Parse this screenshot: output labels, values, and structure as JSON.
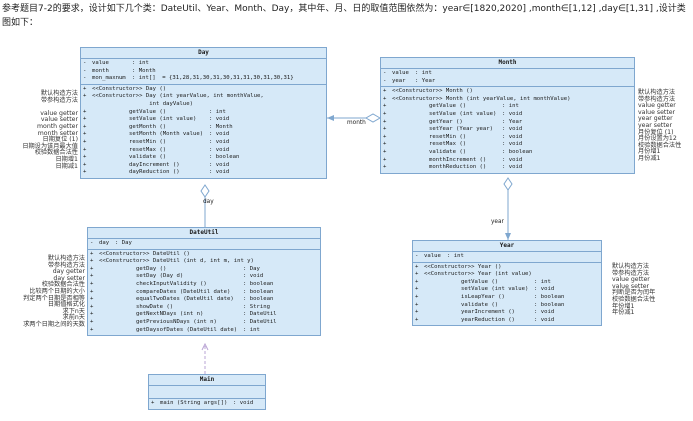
{
  "intro": "参考题目7-2的要求，设计如下几个类：DateUtil、Year、Month、Day，其中年、月、日的取值范围依然为：year∈[1820,2020] ,month∈[1,12] ,day∈[1,31] ,设计类图如下：",
  "day": {
    "title": "Day",
    "attrs": [
      {
        "vis": "-",
        "name": "value",
        "type": ": int"
      },
      {
        "vis": "-",
        "name": "month",
        "type": ": Month"
      },
      {
        "vis": "-",
        "name": "mon_maxnum",
        "type": ": int[]  = {31,28,31,30,31,30,31,31,30,31,30,31}"
      }
    ],
    "ops": [
      {
        "vis": "+",
        "name": "<<Constructor>> Day ()",
        "type": ""
      },
      {
        "vis": "+",
        "name": "<<Constructor>> Day (int yearValue, int monthValue,",
        "type": ""
      },
      {
        "vis": "",
        "name": "                 int dayValue)",
        "type": ""
      },
      {
        "vis": "+",
        "name": "           getValue ()",
        "type": ": int"
      },
      {
        "vis": "+",
        "name": "           setValue (int value)",
        "type": ": void"
      },
      {
        "vis": "+",
        "name": "           getMonth ()",
        "type": ": Month"
      },
      {
        "vis": "+",
        "name": "           setMonth (Month value)",
        "type": ": void"
      },
      {
        "vis": "+",
        "name": "           resetMin ()",
        "type": ": void"
      },
      {
        "vis": "+",
        "name": "           resetMax ()",
        "type": ": void"
      },
      {
        "vis": "+",
        "name": "           validate ()",
        "type": ": boolean"
      },
      {
        "vis": "+",
        "name": "           dayIncrement ()",
        "type": ": void"
      },
      {
        "vis": "+",
        "name": "           dayReduction ()",
        "type": ": void"
      }
    ],
    "notes": [
      "默认构造方法",
      "带参构造方法",
      "",
      "value getter",
      "value setter",
      "month getter",
      "month setter",
      "日期复位 (1)",
      "日期设为该月最大值",
      "校验数据合法性",
      "日期增1",
      "日期减1"
    ]
  },
  "month": {
    "title": "Month",
    "attrs": [
      {
        "vis": "-",
        "name": "value",
        "type": ": int"
      },
      {
        "vis": "-",
        "name": "year",
        "type": ": Year"
      }
    ],
    "ops": [
      {
        "vis": "+",
        "name": "<<Constructor>> Month ()",
        "type": ""
      },
      {
        "vis": "+",
        "name": "<<Constructor>> Month (int yearValue, int monthValue)",
        "type": ""
      },
      {
        "vis": "+",
        "name": "           getValue ()",
        "type": ": int"
      },
      {
        "vis": "+",
        "name": "           setValue (int value)",
        "type": ": void"
      },
      {
        "vis": "+",
        "name": "           getYear ()",
        "type": ": Year"
      },
      {
        "vis": "+",
        "name": "           setYear (Year year)",
        "type": ": void"
      },
      {
        "vis": "+",
        "name": "           resetMin ()",
        "type": ": void"
      },
      {
        "vis": "+",
        "name": "           resetMax ()",
        "type": ": void"
      },
      {
        "vis": "+",
        "name": "           validate ()",
        "type": ": boolean"
      },
      {
        "vis": "+",
        "name": "           monthIncrement ()",
        "type": ": void"
      },
      {
        "vis": "+",
        "name": "           monthReduction ()",
        "type": ": void"
      }
    ],
    "notes": [
      "默认构造方法",
      "带参构造方法",
      "value getter",
      "value setter",
      "year getter",
      "year setter",
      "月份复位 (1)",
      "月份设置为12",
      "校验数据合法性",
      "月份增1",
      "月份减1"
    ]
  },
  "dateutil": {
    "title": "DateUtil",
    "attrs": [
      {
        "vis": "-",
        "name": "day",
        "type": ": Day"
      }
    ],
    "ops": [
      {
        "vis": "+",
        "name": "<<Constructor>> DateUtil ()",
        "type": ""
      },
      {
        "vis": "+",
        "name": "<<Constructor>> DateUtil (int d, int m, int y)",
        "type": ""
      },
      {
        "vis": "+",
        "name": "           getDay ()",
        "type": ": Day"
      },
      {
        "vis": "+",
        "name": "           setDay (Day d)",
        "type": ": void"
      },
      {
        "vis": "+",
        "name": "           checkInputValidity ()",
        "type": ": boolean"
      },
      {
        "vis": "+",
        "name": "           compareDates (DateUtil date)",
        "type": ": boolean"
      },
      {
        "vis": "+",
        "name": "           equalTwoDates (DateUtil date)",
        "type": ": boolean"
      },
      {
        "vis": "+",
        "name": "           showDate ()",
        "type": ": String"
      },
      {
        "vis": "+",
        "name": "           getNextNDays (int n)",
        "type": ": DateUtil"
      },
      {
        "vis": "+",
        "name": "           getPreviousNDays (int n)",
        "type": ": DateUtil"
      },
      {
        "vis": "+",
        "name": "           getDaysofDates (DateUtil date)",
        "type": ": int"
      }
    ],
    "notes": [
      "默认构造方法",
      "带参构造方法",
      "day getter",
      "day setter",
      "校验数据合法性",
      "比较两个日期的大小",
      "判定两个日期是否相等",
      "日期值格式化",
      "求下n天",
      "求前n天",
      "求两个日期之间的天数"
    ]
  },
  "year": {
    "title": "Year",
    "attrs": [
      {
        "vis": "-",
        "name": "value",
        "type": ": int"
      }
    ],
    "ops": [
      {
        "vis": "+",
        "name": "<<Constructor>> Year ()",
        "type": ""
      },
      {
        "vis": "+",
        "name": "<<Constructor>> Year (int value)",
        "type": ""
      },
      {
        "vis": "+",
        "name": "           getValue ()",
        "type": ": int"
      },
      {
        "vis": "+",
        "name": "           setValue (int value)",
        "type": ": void"
      },
      {
        "vis": "+",
        "name": "           isLeapYear ()",
        "type": ": boolean"
      },
      {
        "vis": "+",
        "name": "           validate ()",
        "type": ": boolean"
      },
      {
        "vis": "+",
        "name": "           yearIncrement ()",
        "type": ": void"
      },
      {
        "vis": "+",
        "name": "           yearReduction ()",
        "type": ": void"
      }
    ],
    "notes": [
      "默认构造方法",
      "带参构造方法",
      "value getter",
      "value setter",
      "判断是否为闰年",
      "校验数据合法性",
      "年份增1",
      "年份减1"
    ]
  },
  "main": {
    "title": "Main",
    "ops": [
      {
        "vis": "+",
        "name": "main (String args[])",
        "type": ": void"
      }
    ]
  },
  "labels": {
    "month": "month",
    "day": "day",
    "year": "year"
  }
}
